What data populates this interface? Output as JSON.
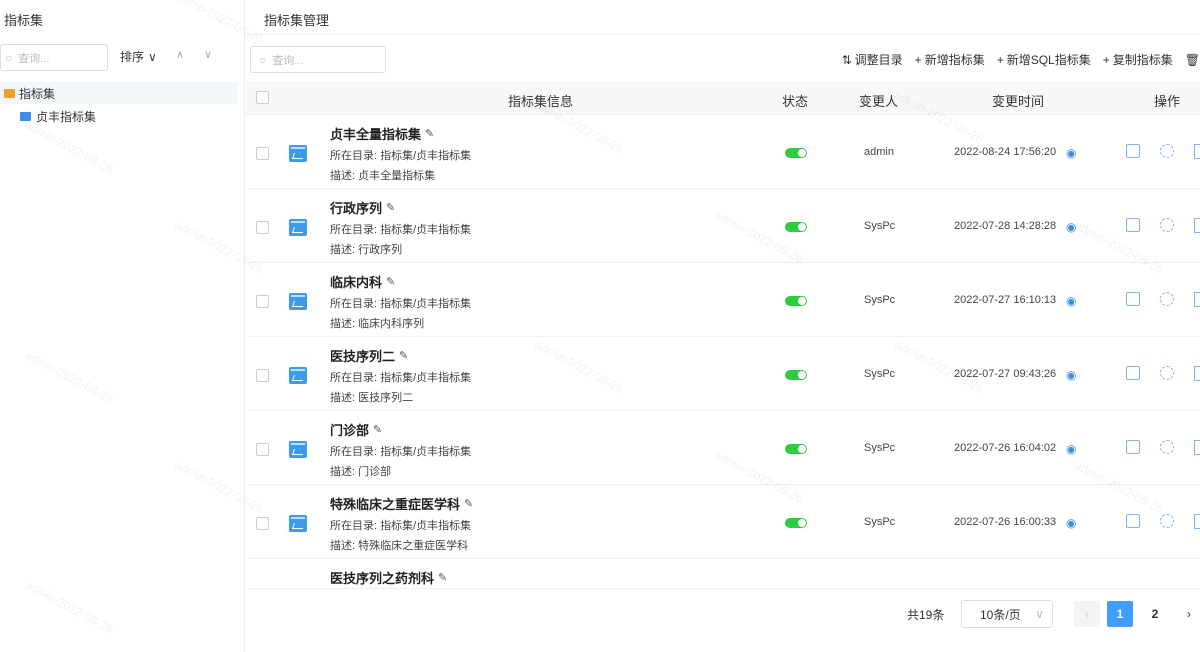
{
  "left": {
    "title": "指标集",
    "search_placeholder": "查询...",
    "sort_label": "排序",
    "tree": {
      "root_label": "指标集",
      "child_label": "贞丰指标集"
    }
  },
  "right": {
    "title": "指标集管理",
    "search_placeholder": "查询...",
    "toolbar": {
      "adjust": "调整目录",
      "add": "新增指标集",
      "add_sql": "新增SQL指标集",
      "copy": "复制指标集"
    },
    "columns": {
      "info": "指标集信息",
      "status": "状态",
      "changer": "变更人",
      "time": "变更时间",
      "ops": "操作"
    },
    "rows": [
      {
        "name": "贞丰全量指标集",
        "dir": "所在目录: 指标集/贞丰指标集",
        "desc": "描述: 贞丰全量指标集",
        "user": "admin",
        "time": "2022-08-24 17:56:20"
      },
      {
        "name": "行政序列",
        "dir": "所在目录: 指标集/贞丰指标集",
        "desc": "描述: 行政序列",
        "user": "SysPc",
        "time": "2022-07-28 14:28:28"
      },
      {
        "name": "临床内科",
        "dir": "所在目录: 指标集/贞丰指标集",
        "desc": "描述: 临床内科序列",
        "user": "SysPc",
        "time": "2022-07-27 16:10:13"
      },
      {
        "name": "医技序列二",
        "dir": "所在目录: 指标集/贞丰指标集",
        "desc": "描述: 医技序列二",
        "user": "SysPc",
        "time": "2022-07-27 09:43:26"
      },
      {
        "name": "门诊部",
        "dir": "所在目录: 指标集/贞丰指标集",
        "desc": "描述: 门诊部",
        "user": "SysPc",
        "time": "2022-07-26 16:04:02"
      },
      {
        "name": "特殊临床之重症医学科",
        "dir": "所在目录: 指标集/贞丰指标集",
        "desc": "描述: 特殊临床之重症医学科",
        "user": "SysPc",
        "time": "2022-07-26 16:00:33"
      }
    ],
    "partial_row_name": "医技序列之药剂科",
    "pagination": {
      "total": "共19条",
      "per_page": "10条/页",
      "page1": "1",
      "page2": "2"
    }
  },
  "watermark": "admin-2022-08-26"
}
